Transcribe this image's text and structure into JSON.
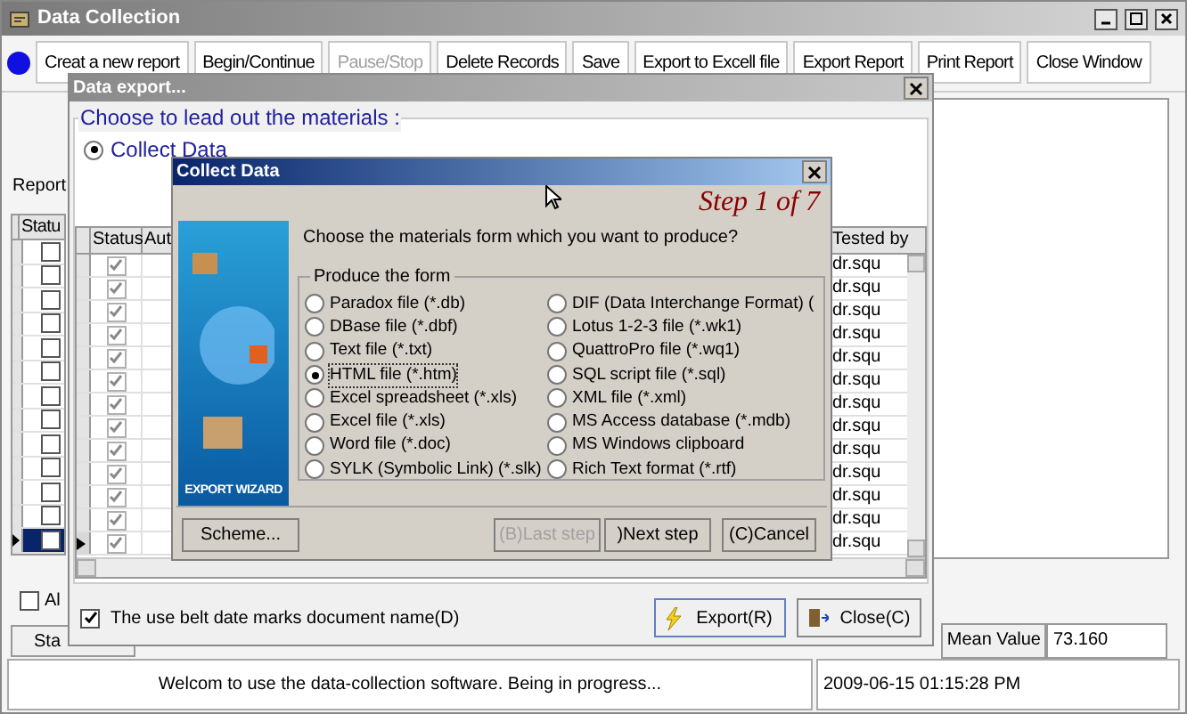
{
  "window": {
    "title": "Data Collection"
  },
  "toolbar": {
    "buttons": [
      {
        "label": "Creat a new report",
        "disabled": false
      },
      {
        "label": "Begin/Continue",
        "disabled": false
      },
      {
        "label": "Pause/Stop",
        "disabled": true
      },
      {
        "label": "Delete Records",
        "disabled": false
      },
      {
        "label": "Save",
        "disabled": false
      },
      {
        "label": "Export to Excell file",
        "disabled": false
      },
      {
        "label": "Export Report",
        "disabled": false
      },
      {
        "label": "Print Report",
        "disabled": false
      },
      {
        "label": "Close Window",
        "disabled": false
      }
    ]
  },
  "main": {
    "report_label": "Report",
    "grid": {
      "header": "Statu",
      "rows": [
        {
          "checked": false,
          "selected": false
        },
        {
          "checked": false,
          "selected": false
        },
        {
          "checked": false,
          "selected": false
        },
        {
          "checked": false,
          "selected": false
        },
        {
          "checked": false,
          "selected": false
        },
        {
          "checked": false,
          "selected": false
        },
        {
          "checked": false,
          "selected": false
        },
        {
          "checked": false,
          "selected": false
        },
        {
          "checked": false,
          "selected": false
        },
        {
          "checked": false,
          "selected": false
        },
        {
          "checked": false,
          "selected": false
        },
        {
          "checked": false,
          "selected": false
        },
        {
          "checked": false,
          "selected": true
        }
      ]
    },
    "all_checkbox": {
      "label": "Al",
      "checked": false
    },
    "bottom_button": "Sta",
    "mean_value": {
      "label": "Mean Value",
      "value": "73.160"
    }
  },
  "export_dialog": {
    "title": "Data export...",
    "group_label": "Choose to lead out the materials :",
    "options": [
      {
        "label": "Collect Data",
        "selected": true
      }
    ],
    "grid": {
      "columns": [
        "Status",
        "Aut",
        "Tested by"
      ],
      "rows": [
        {
          "checked": true,
          "tested_by": "dr.squ",
          "selected": false
        },
        {
          "checked": true,
          "tested_by": "dr.squ",
          "selected": false
        },
        {
          "checked": true,
          "tested_by": "dr.squ",
          "selected": false
        },
        {
          "checked": true,
          "tested_by": "dr.squ",
          "selected": false
        },
        {
          "checked": true,
          "tested_by": "dr.squ",
          "selected": false
        },
        {
          "checked": true,
          "tested_by": "dr.squ",
          "selected": false
        },
        {
          "checked": true,
          "tested_by": "dr.squ",
          "selected": false
        },
        {
          "checked": true,
          "tested_by": "dr.squ",
          "selected": false
        },
        {
          "checked": true,
          "tested_by": "dr.squ",
          "selected": false
        },
        {
          "checked": true,
          "tested_by": "dr.squ",
          "selected": false
        },
        {
          "checked": true,
          "tested_by": "dr.squ",
          "selected": false
        },
        {
          "checked": true,
          "tested_by": "dr.squ",
          "selected": false
        },
        {
          "checked": true,
          "tested_by": "dr.squ",
          "selected": true
        }
      ]
    },
    "date_checkbox": {
      "label": "The use belt date marks document name(D)",
      "checked": true
    },
    "buttons": [
      {
        "kind": "export",
        "label": "Export(R)"
      },
      {
        "kind": "close",
        "label": "Close(C)"
      }
    ]
  },
  "wizard": {
    "title": "Collect Data",
    "step": "Step 1 of 7",
    "question": "Choose the materials form which you want to produce?",
    "banner_text": "EXPORT WIZARD",
    "group_label": "Produce the form",
    "formats": [
      {
        "label": "Paradox file (*.db)",
        "selected": false
      },
      {
        "label": "DBase file (*.dbf)",
        "selected": false
      },
      {
        "label": "Text file (*.txt)",
        "selected": false
      },
      {
        "label": "HTML file (*.htm)",
        "selected": true
      },
      {
        "label": "Excel spreadsheet (*.xls)",
        "selected": false
      },
      {
        "label": "Excel file (*.xls)",
        "selected": false
      },
      {
        "label": "Word file (*.doc)",
        "selected": false
      },
      {
        "label": "SYLK (Symbolic Link) (*.slk)",
        "selected": false
      },
      {
        "label": "DIF (Data Interchange Format) (",
        "selected": false
      },
      {
        "label": "Lotus 1-2-3 file (*.wk1)",
        "selected": false
      },
      {
        "label": "QuattroPro file (*.wq1)",
        "selected": false
      },
      {
        "label": "SQL script file (*.sql)",
        "selected": false
      },
      {
        "label": "XML file (*.xml)",
        "selected": false
      },
      {
        "label": "MS Access database (*.mdb)",
        "selected": false
      },
      {
        "label": "MS Windows clipboard",
        "selected": false
      },
      {
        "label": "Rich Text format (*.rtf)",
        "selected": false
      }
    ],
    "buttons": [
      {
        "label": "Scheme...",
        "disabled": false
      },
      {
        "label": "(B)Last step",
        "disabled": true
      },
      {
        "label": ")Next step",
        "disabled": false
      },
      {
        "label": "(C)Cancel",
        "disabled": false
      }
    ]
  },
  "status_bar": {
    "message": "Welcom to use the data-collection software. Being in progress...",
    "time": "2009-06-15 01:15:28 PM"
  }
}
